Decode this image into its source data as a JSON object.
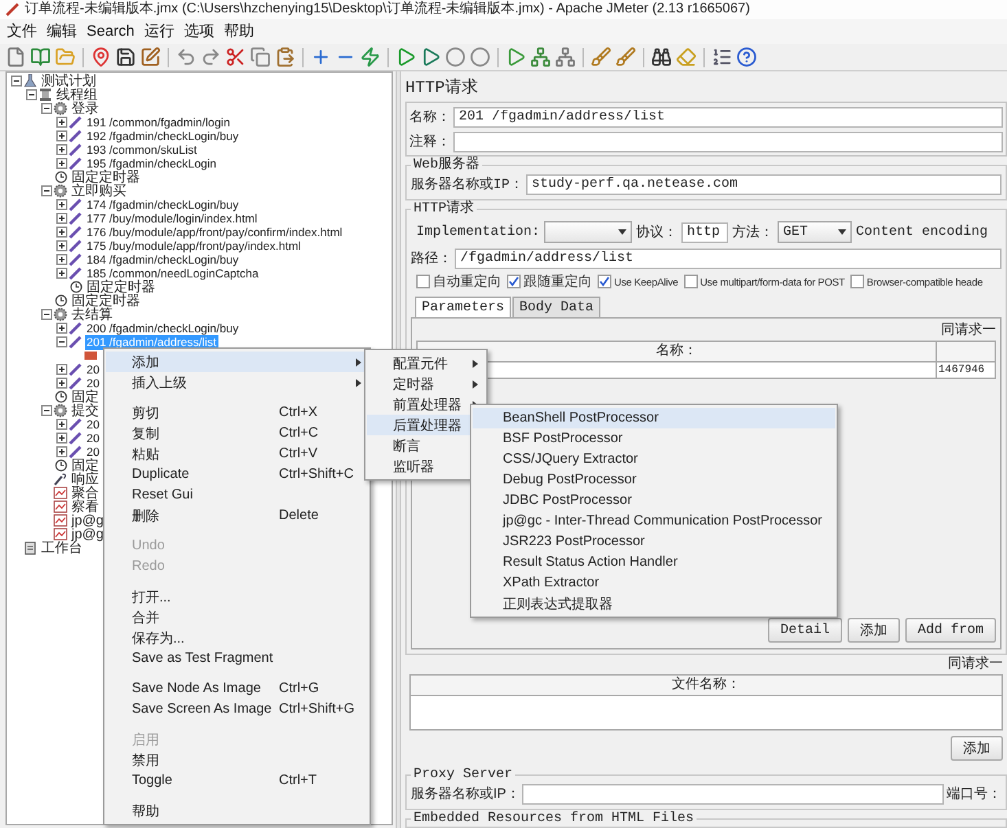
{
  "window": {
    "title": "订单流程-未编辑版本.jmx (C:\\Users\\hzchenying15\\Desktop\\订单流程-未编辑版本.jmx) - Apache JMeter (2.13 r1665067)"
  },
  "menu_bar": [
    "文件",
    "编辑",
    "Search",
    "运行",
    "选项",
    "帮助"
  ],
  "tree": [
    {
      "label": "测试计划",
      "kind": "plan",
      "expanded": true,
      "selected": false,
      "children": [
        {
          "label": "线程组",
          "kind": "thread-group",
          "expanded": true,
          "selected": false,
          "children": [
            {
              "label": "登录",
              "kind": "controller",
              "expanded": true,
              "selected": false,
              "children": [
                {
                  "label": "191 /common/fgadmin/login",
                  "kind": "sampler",
                  "expanded": false,
                  "selected": false
                },
                {
                  "label": "192 /fgadmin/checkLogin/buy",
                  "kind": "sampler",
                  "expanded": false,
                  "selected": false
                },
                {
                  "label": "193 /common/skuList",
                  "kind": "sampler",
                  "expanded": false,
                  "selected": false
                },
                {
                  "label": "195 /fgadmin/checkLogin",
                  "kind": "sampler",
                  "expanded": false,
                  "selected": false
                }
              ]
            },
            {
              "label": "固定定时器",
              "kind": "timer",
              "selected": false
            },
            {
              "label": "立即购买",
              "kind": "controller",
              "expanded": true,
              "selected": false,
              "children": [
                {
                  "label": "174 /fgadmin/checkLogin/buy",
                  "kind": "sampler",
                  "expanded": false,
                  "selected": false
                },
                {
                  "label": "177 /buy/module/login/index.html",
                  "kind": "sampler",
                  "expanded": false,
                  "selected": false
                },
                {
                  "label": "176 /buy/module/app/front/pay/confirm/index.html",
                  "kind": "sampler",
                  "expanded": false,
                  "selected": false
                },
                {
                  "label": "175 /buy/module/app/front/pay/index.html",
                  "kind": "sampler",
                  "expanded": false,
                  "selected": false
                },
                {
                  "label": "184 /fgadmin/checkLogin/buy",
                  "kind": "sampler",
                  "expanded": false,
                  "selected": false
                },
                {
                  "label": "185 /common/needLoginCaptcha",
                  "kind": "sampler",
                  "expanded": false,
                  "selected": false
                },
                {
                  "label": "固定定时器",
                  "kind": "timer",
                  "selected": false
                }
              ]
            },
            {
              "label": "固定定时器",
              "kind": "timer",
              "selected": false
            },
            {
              "label": "去结算",
              "kind": "controller",
              "expanded": true,
              "selected": false,
              "children": [
                {
                  "label": "200 /fgadmin/checkLogin/buy",
                  "kind": "sampler",
                  "expanded": false,
                  "selected": false
                },
                {
                  "label": "201 /fgadmin/address/list",
                  "kind": "sampler",
                  "expanded": true,
                  "selected": true,
                  "children": [
                    {
                      "kind": "postprocessor",
                      "selected": false
                    }
                  ]
                },
                {
                  "label": "20",
                  "kind": "sampler",
                  "expanded": false,
                  "selected": false
                },
                {
                  "label": "20",
                  "kind": "sampler",
                  "expanded": false,
                  "selected": false
                }
              ]
            },
            {
              "label": "固定",
              "kind": "timer",
              "selected": false
            },
            {
              "label": "提交",
              "kind": "controller",
              "expanded": true,
              "selected": false,
              "children": [
                {
                  "label": "20",
                  "kind": "sampler",
                  "expanded": false,
                  "selected": false
                },
                {
                  "label": "20",
                  "kind": "sampler",
                  "expanded": false,
                  "selected": false
                },
                {
                  "label": "20",
                  "kind": "sampler",
                  "expanded": false,
                  "selected": false
                }
              ]
            },
            {
              "label": "固定",
              "kind": "timer",
              "selected": false
            },
            {
              "label": "响应",
              "kind": "assertion",
              "selected": false
            },
            {
              "label": "聚合",
              "kind": "listener",
              "selected": false
            },
            {
              "label": "察看",
              "kind": "listener",
              "selected": false
            },
            {
              "label": "jp@g",
              "kind": "listener",
              "selected": false
            },
            {
              "label": "jp@g",
              "kind": "listener",
              "selected": false
            }
          ]
        }
      ]
    },
    {
      "label": "工作台",
      "kind": "workbench",
      "selected": false
    }
  ],
  "context_menu": [
    {
      "kind": "item",
      "label": "添加",
      "submenu": true,
      "disabled": false,
      "selected": true
    },
    {
      "kind": "item",
      "label": "插入上级",
      "submenu": true,
      "disabled": false,
      "selected": false
    },
    {
      "kind": "gap"
    },
    {
      "kind": "item",
      "label": "剪切",
      "shortcut": "Ctrl+X",
      "disabled": false,
      "selected": false
    },
    {
      "kind": "item",
      "label": "复制",
      "shortcut": "Ctrl+C",
      "disabled": false,
      "selected": false
    },
    {
      "kind": "item",
      "label": "粘贴",
      "shortcut": "Ctrl+V",
      "disabled": false,
      "selected": false
    },
    {
      "kind": "item",
      "label": "Duplicate",
      "shortcut": "Ctrl+Shift+C",
      "disabled": false,
      "selected": false
    },
    {
      "kind": "item",
      "label": "Reset Gui",
      "disabled": false,
      "selected": false
    },
    {
      "kind": "item",
      "label": "删除",
      "shortcut": "Delete",
      "disabled": false,
      "selected": false
    },
    {
      "kind": "gap"
    },
    {
      "kind": "item",
      "label": "Undo",
      "disabled": true,
      "selected": false
    },
    {
      "kind": "item",
      "label": "Redo",
      "disabled": true,
      "selected": false
    },
    {
      "kind": "gap"
    },
    {
      "kind": "item",
      "label": "打开...",
      "disabled": false,
      "selected": false
    },
    {
      "kind": "item",
      "label": "合并",
      "disabled": false,
      "selected": false
    },
    {
      "kind": "item",
      "label": "保存为...",
      "disabled": false,
      "selected": false
    },
    {
      "kind": "item",
      "label": "Save as Test Fragment",
      "disabled": false,
      "selected": false
    },
    {
      "kind": "gap"
    },
    {
      "kind": "item",
      "label": "Save Node As Image",
      "shortcut": "Ctrl+G",
      "disabled": false,
      "selected": false
    },
    {
      "kind": "item",
      "label": "Save Screen As Image",
      "shortcut": "Ctrl+Shift+G",
      "disabled": false,
      "selected": false
    },
    {
      "kind": "gap"
    },
    {
      "kind": "item",
      "label": "启用",
      "disabled": true,
      "selected": false
    },
    {
      "kind": "item",
      "label": "禁用",
      "disabled": false,
      "selected": false
    },
    {
      "kind": "item",
      "label": "Toggle",
      "shortcut": "Ctrl+T",
      "disabled": false,
      "selected": false
    },
    {
      "kind": "gap"
    },
    {
      "kind": "item",
      "label": "帮助",
      "disabled": false,
      "selected": false
    }
  ],
  "add_submenu": [
    {
      "label": "配置元件",
      "selected": false
    },
    {
      "label": "定时器",
      "selected": false
    },
    {
      "label": "前置处理器",
      "selected": false
    },
    {
      "label": "后置处理器",
      "selected": true
    },
    {
      "label": "断言",
      "selected": false
    },
    {
      "label": "监听器",
      "selected": false
    }
  ],
  "postprocessor_submenu": [
    {
      "label": "BeanShell PostProcessor",
      "selected": true
    },
    {
      "label": "BSF PostProcessor",
      "selected": false
    },
    {
      "label": "CSS/JQuery Extractor",
      "selected": false
    },
    {
      "label": "Debug PostProcessor",
      "selected": false
    },
    {
      "label": "JDBC PostProcessor",
      "selected": false
    },
    {
      "label": "jp@gc - Inter-Thread Communication PostProcessor",
      "selected": false
    },
    {
      "label": "JSR223 PostProcessor",
      "selected": false
    },
    {
      "label": "Result Status Action Handler",
      "selected": false
    },
    {
      "label": "XPath Extractor",
      "selected": false
    },
    {
      "label": "正则表达式提取器",
      "selected": false
    }
  ],
  "editor": {
    "title": "HTTP请求",
    "name": {
      "label": "名称：",
      "value": "201 /fgadmin/address/list"
    },
    "comments": {
      "label": "注释："
    },
    "web_server": {
      "legend": "Web服务器",
      "label": "服务器名称或IP：",
      "value": "study-perf.qa.netease.com"
    },
    "http_request": {
      "legend": "HTTP请求",
      "implementation_label": "Implementation:",
      "protocol_label": "协议：",
      "protocol": "http",
      "method_label": "方法：",
      "method": "GET",
      "content_encoding_label": "Content encoding",
      "path_label": "路径：",
      "path": "/fgadmin/address/list",
      "options": [
        {
          "label": "自动重定向",
          "checked": false
        },
        {
          "label": "跟随重定向",
          "checked": true
        },
        {
          "label": "Use KeepAlive",
          "checked": true
        },
        {
          "label": "Use multipart/form-data for POST",
          "checked": false
        },
        {
          "label": "Browser-compatible heade",
          "checked": false
        }
      ],
      "tabs": [
        {
          "label": "Parameters",
          "selected": true
        },
        {
          "label": "Body Data",
          "selected": false
        }
      ],
      "parameters": {
        "caption": "同请求一",
        "column_1": "名称：",
        "rows": [
          {
            "column_2": "1467946"
          }
        ],
        "buttons": [
          "Detail",
          "添加",
          "Add from"
        ]
      }
    },
    "files": {
      "caption": "同请求一",
      "column_1": "文件名称：",
      "buttons": [
        "添加"
      ]
    },
    "proxy": {
      "legend": "Proxy Server",
      "server_label": "服务器名称或IP：",
      "port_label": "端口号："
    },
    "embedded": {
      "legend": "Embedded Resources from HTML Files"
    }
  }
}
